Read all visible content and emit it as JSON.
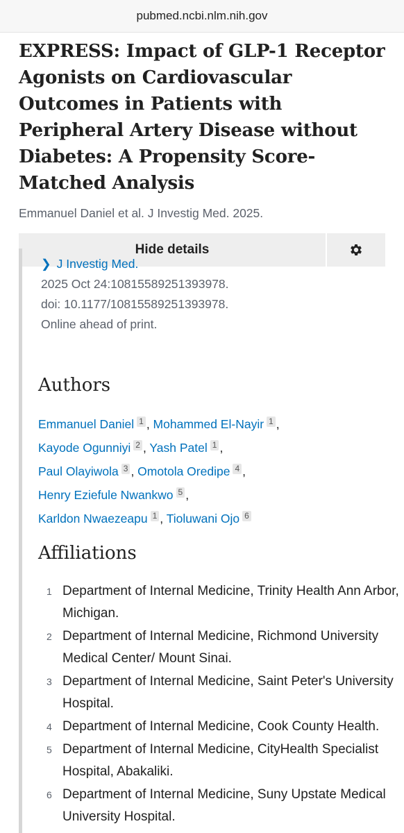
{
  "browser": {
    "url": "pubmed.ncbi.nlm.nih.gov"
  },
  "article": {
    "title": "EXPRESS: Impact of GLP-1 Receptor Agonists on Cardiovascular Outcomes in Patients with Peripheral Artery Disease without Diabetes: A Propensity Score-Matched Analysis",
    "short_citation": "Emmanuel Daniel et al. J Investig Med. 2025."
  },
  "details_bar": {
    "hide_label": "Hide details",
    "settings_icon": "gear-icon"
  },
  "details": {
    "journal": "J Investig Med.",
    "date_line": "2025 Oct 24:10815589251393978.",
    "doi_line": "doi: 10.1177/10815589251393978.",
    "status_line": "Online ahead of print."
  },
  "authors": {
    "heading": "Authors",
    "list": [
      {
        "name": "Emmanuel Daniel",
        "aff": "1"
      },
      {
        "name": "Mohammed El-Nayir",
        "aff": "1"
      },
      {
        "name": "Kayode Ogunniyi",
        "aff": "2"
      },
      {
        "name": "Yash Patel",
        "aff": "1"
      },
      {
        "name": "Paul Olayiwola",
        "aff": "3"
      },
      {
        "name": "Omotola Oredipe",
        "aff": "4"
      },
      {
        "name": "Henry Eziefule Nwankwo",
        "aff": "5"
      },
      {
        "name": "Karldon Nwaezeapu",
        "aff": "1"
      },
      {
        "name": "Tioluwani Ojo",
        "aff": "6"
      }
    ]
  },
  "affiliations": {
    "heading": "Affiliations",
    "list": [
      {
        "num": "1",
        "text": "Department of Internal Medicine, Trinity Health Ann Arbor, Michigan."
      },
      {
        "num": "2",
        "text": "Department of Internal Medicine, Richmond University Medical Center/ Mount Sinai."
      },
      {
        "num": "3",
        "text": "Department of Internal Medicine, Saint Peter's University Hospital."
      },
      {
        "num": "4",
        "text": "Department of Internal Medicine, Cook County Health."
      },
      {
        "num": "5",
        "text": "Department of Internal Medicine, CityHealth Specialist Hospital, Abakaliki."
      },
      {
        "num": "6",
        "text": "Department of Internal Medicine, Suny Upstate Medical University Hospital."
      }
    ]
  }
}
